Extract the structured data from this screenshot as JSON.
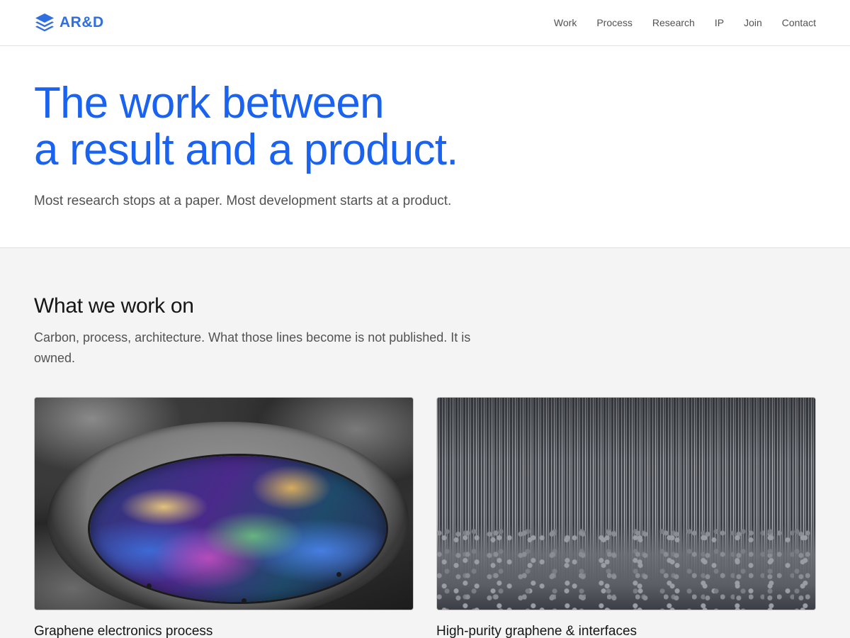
{
  "header": {
    "logo_text": "AR&D",
    "logo_icon": "stacked-layers-icon",
    "brand_color": "#2f6fe0",
    "nav": [
      {
        "label": "Work"
      },
      {
        "label": "Process"
      },
      {
        "label": "Research"
      },
      {
        "label": "IP"
      },
      {
        "label": "Join"
      },
      {
        "label": "Contact"
      }
    ]
  },
  "hero": {
    "title_line1": "The work between",
    "title_line2": "a result and a product.",
    "title_color": "#1a62f0",
    "subtitle": "Most research stops at a paper. Most development starts at a product."
  },
  "work": {
    "title": "What we work on",
    "description": "Carbon, process, architecture. What those lines become is not published. It is owned.",
    "cards": [
      {
        "title": "Graphene electronics process",
        "image": "iridescent-wafer-image"
      },
      {
        "title": "High-purity graphene & interfaces",
        "image": "nanotube-forest-image"
      }
    ]
  }
}
